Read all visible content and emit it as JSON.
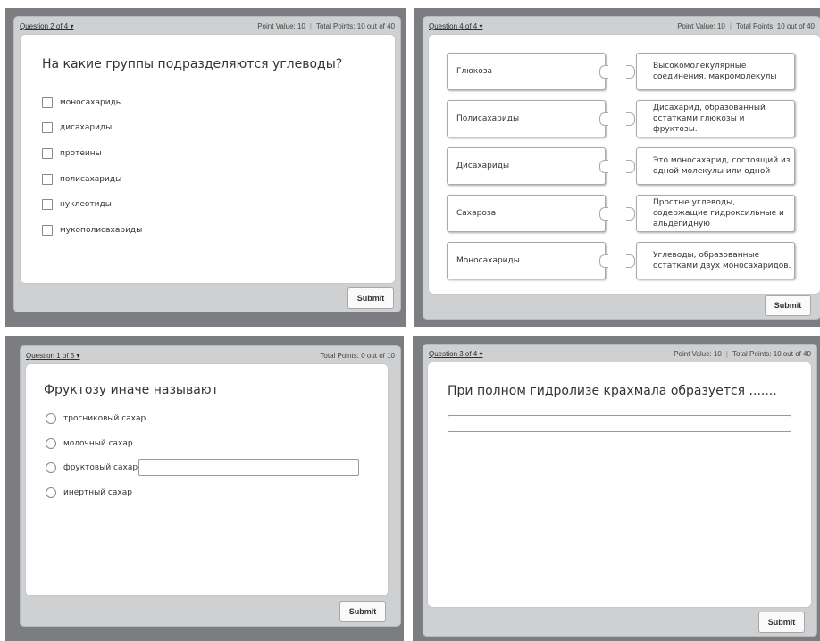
{
  "q1": {
    "question_label": "Question 2 of 4 ▾",
    "point_value": "Point Value: 10",
    "total_points": "Total Points: 10 out of 40",
    "title": "На какие группы подразделяются углеводы?",
    "options": [
      "моносахариды",
      "дисахариды",
      "протеины",
      "полисахариды",
      "нуклеотиды",
      "мукополисахариды"
    ],
    "submit": "Submit"
  },
  "q2": {
    "question_label": "Question 4 of 4 ▾",
    "point_value": "Point Value: 10",
    "total_points": "Total Points: 10 out of 40",
    "left_items": [
      "Глюкоза",
      "Полисахариды",
      "Дисахариды",
      "Сахароза",
      "Моносахариды"
    ],
    "right_items": [
      "Высокомолекулярные соединения, макромолекулы",
      "Дисахарид, образованный остатками глюкозы и фруктозы.",
      "Это моносахарид, состоящий из одной молекулы или одной",
      "Простые углеводы, содержащие гидроксильные и альдегидную",
      "Углеводы, образованные остатками двух моносахаридов."
    ],
    "submit": "Submit"
  },
  "q3": {
    "question_label": "Question 1 of 5 ▾",
    "total_points": "Total Points: 0 out of 10",
    "title": "Фруктозу иначе называют",
    "options": [
      "тросниковый сахар",
      "молочный сахар",
      "фруктовый сахар",
      "инертный сахар"
    ],
    "submit": "Submit"
  },
  "q4": {
    "question_label": "Question 3 of 4 ▾",
    "point_value": "Point Value: 10",
    "total_points": "Total Points: 10 out of 40",
    "title": "При полном гидролизе крахмала образуется .......",
    "answer_value": "",
    "submit": "Submit"
  }
}
